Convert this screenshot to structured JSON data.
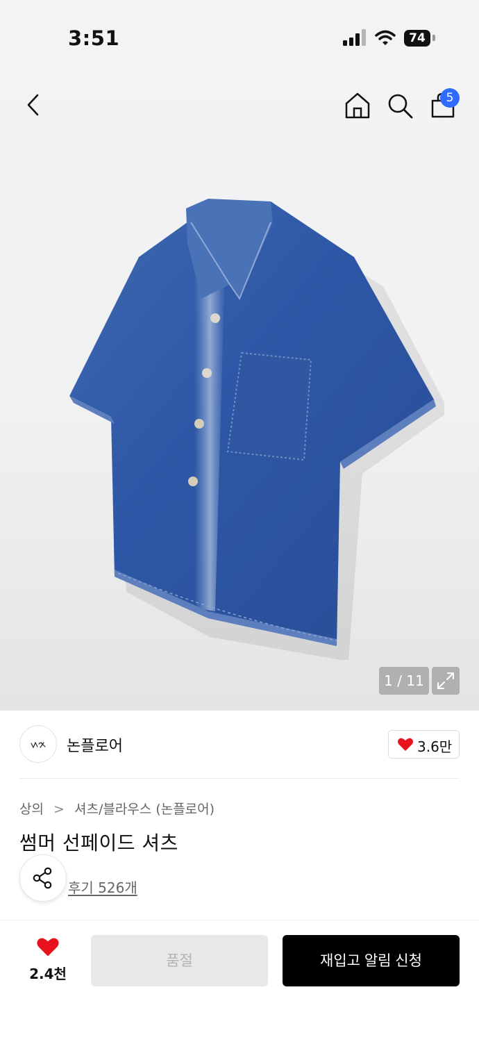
{
  "status_bar": {
    "time": "3:51",
    "battery": "74"
  },
  "header": {
    "cart_count": "5"
  },
  "gallery": {
    "page_indicator": "1 / 11"
  },
  "brand": {
    "name": "논플로어",
    "like_count": "3.6만"
  },
  "product": {
    "breadcrumb": [
      "상의",
      "셔츠/블라우스 (논플로어)"
    ],
    "breadcrumb_separator": ">",
    "title": "썸머 선페이드 셔츠",
    "review_link": "후기 526개"
  },
  "bottom_bar": {
    "wish_count": "2.4천",
    "soldout_label": "품절",
    "restock_label": "재입고 알림 신청"
  },
  "colors": {
    "accent_badge": "#2f6bff",
    "heart": "#e8121c",
    "primary_button": "#000000",
    "disabled_button": "#e8e8e8"
  },
  "icons": [
    "back-icon",
    "home-icon",
    "search-icon",
    "shopping-bag-icon",
    "expand-icon",
    "heart-icon",
    "share-icon",
    "signal-icon",
    "wifi-icon",
    "battery-icon"
  ]
}
